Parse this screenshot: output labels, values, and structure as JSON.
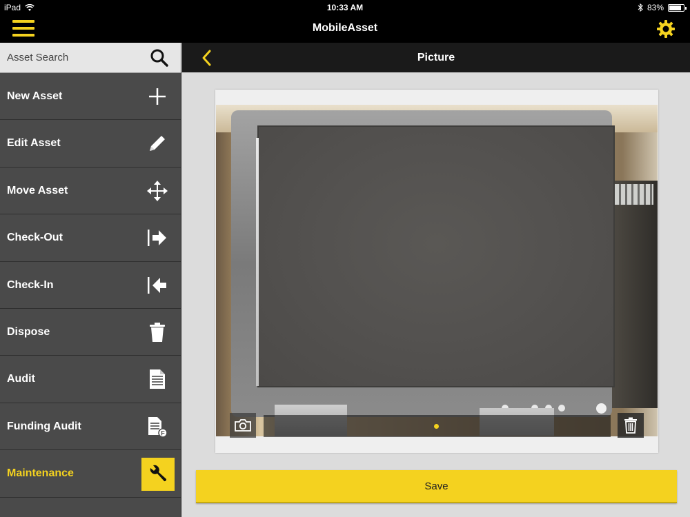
{
  "status_bar": {
    "device": "iPad",
    "time": "10:33 AM",
    "battery": "83%",
    "battery_level": 0.83
  },
  "nav": {
    "title": "MobileAsset"
  },
  "sidebar": {
    "search_placeholder": "Asset Search",
    "items": [
      {
        "label": "New Asset",
        "icon": "plus-icon"
      },
      {
        "label": "Edit Asset",
        "icon": "pencil-icon"
      },
      {
        "label": "Move Asset",
        "icon": "move-arrows-icon"
      },
      {
        "label": "Check-Out",
        "icon": "check-out-arrow-icon"
      },
      {
        "label": "Check-In",
        "icon": "check-in-arrow-icon"
      },
      {
        "label": "Dispose",
        "icon": "trash-icon"
      },
      {
        "label": "Audit",
        "icon": "document-icon"
      },
      {
        "label": "Funding Audit",
        "icon": "funding-document-icon"
      },
      {
        "label": "Maintenance",
        "icon": "wrench-icon",
        "active": true
      }
    ]
  },
  "content": {
    "title": "Picture",
    "save_label": "Save",
    "photo_description": "Computer monitor photo",
    "page_count": 1,
    "current_page": 1
  },
  "colors": {
    "accent": "#f4d21f",
    "sidebar_bg": "#4a4a4a",
    "bar_bg": "#000000"
  }
}
